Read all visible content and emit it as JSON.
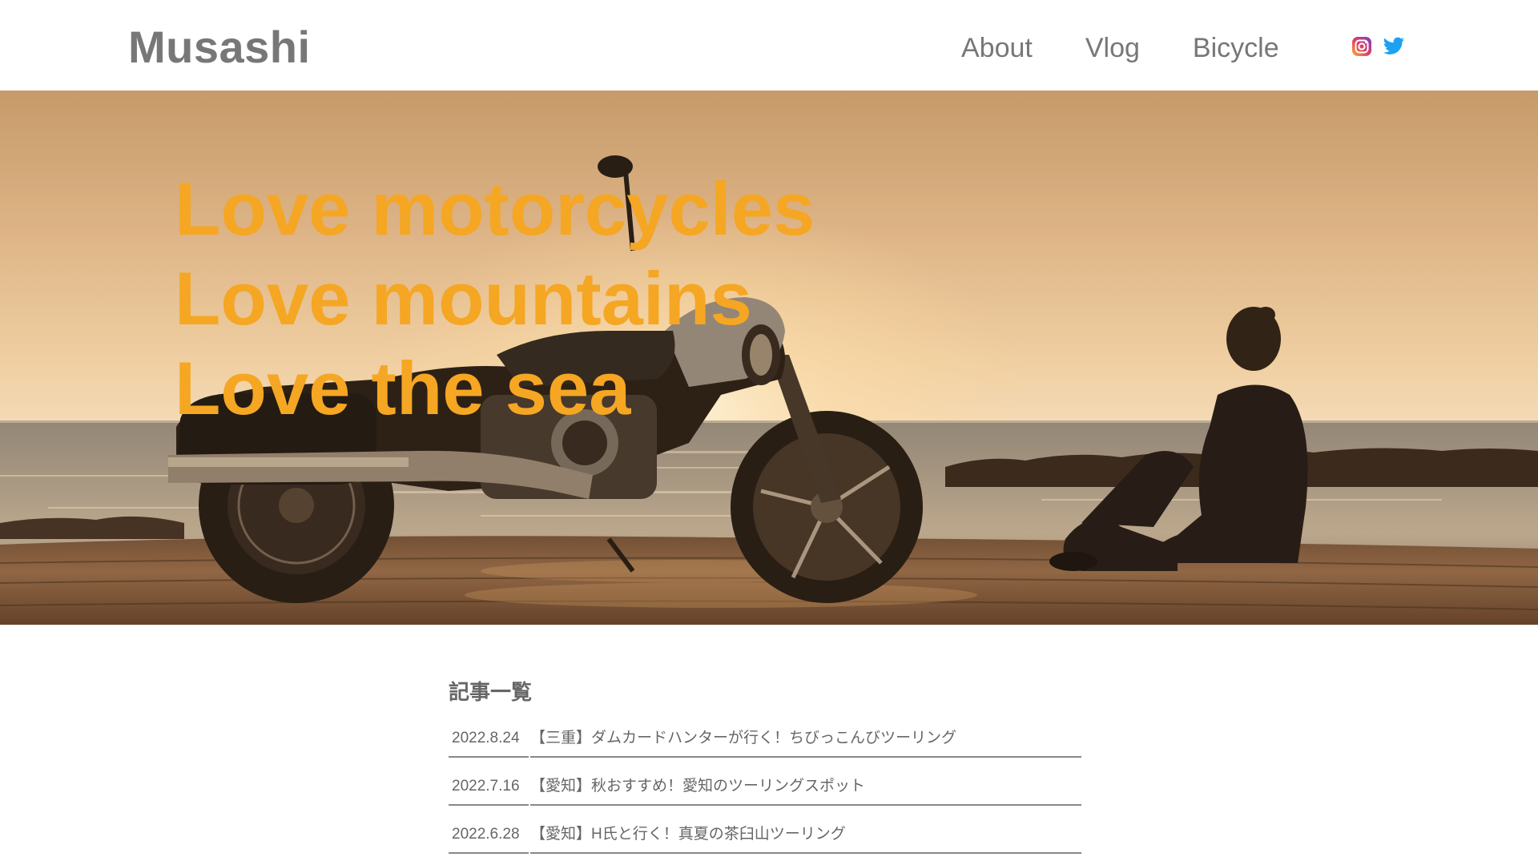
{
  "header": {
    "logo": "Musashi",
    "nav": [
      {
        "label": "About"
      },
      {
        "label": "Vlog"
      },
      {
        "label": "Bicycle"
      }
    ],
    "social": [
      {
        "icon": "instagram-icon"
      },
      {
        "icon": "twitter-icon"
      }
    ]
  },
  "hero": {
    "lines": [
      "Love motorcycles",
      "Love mountains",
      "Love the sea"
    ],
    "text_color": "#f5a623",
    "image_description_icon": "motorcycle-sunset-photo"
  },
  "articles": {
    "title": "記事一覧",
    "items": [
      {
        "date": "2022.8.24",
        "title": "【三重】ダムカードハンターが行く！ちびっこんびツーリング"
      },
      {
        "date": "2022.7.16",
        "title": "【愛知】秋おすすめ！愛知のツーリングスポット"
      },
      {
        "date": "2022.6.28",
        "title": "【愛知】H氏と行く！真夏の茶臼山ツーリング"
      }
    ]
  }
}
